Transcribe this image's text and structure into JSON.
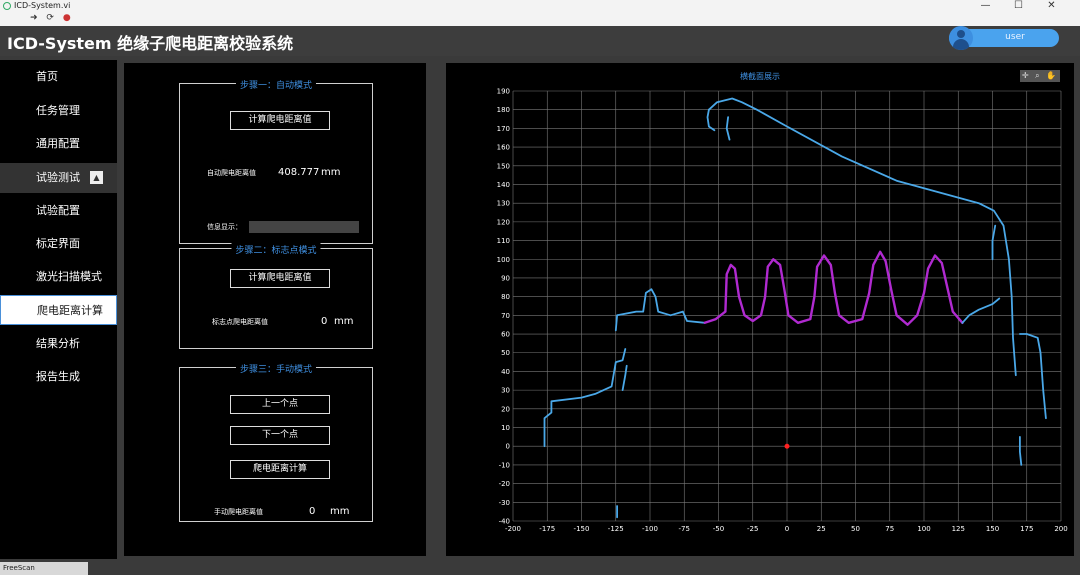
{
  "window": {
    "app_name": "ICD-System.vi",
    "run_tools": "➜ ⟳",
    "stop_glyph": "●",
    "minimize": "—",
    "maximize": "☐",
    "close": "✕"
  },
  "header": {
    "title": "ICD-System 绝缘子爬电距离校验系统",
    "user": "user"
  },
  "sidebar": {
    "items": [
      {
        "label": "首页"
      },
      {
        "label": "任务管理"
      },
      {
        "label": "通用配置"
      },
      {
        "label": "试验测试"
      },
      {
        "label": "试验配置"
      },
      {
        "label": "标定界面"
      },
      {
        "label": "激光扫描模式"
      },
      {
        "label": "爬电距离计算"
      },
      {
        "label": "结果分析"
      },
      {
        "label": "报告生成"
      }
    ],
    "collapse_glyph": "▲"
  },
  "steps": {
    "auto": {
      "title": "步骤一：自动模式",
      "button": "计算爬电距离值",
      "value_label": "自动爬电距离值",
      "value": "408.777",
      "unit": "mm",
      "info_label": "信息显示："
    },
    "marker": {
      "title": "步骤二：标志点模式",
      "button": "计算爬电距离值",
      "value_label": "标志点爬电距离值",
      "value": "0",
      "unit": "mm"
    },
    "manual": {
      "title": "步骤三：手动模式",
      "prev_button": "上一个点",
      "next_button": "下一个点",
      "calc_button": "爬电距离计算",
      "value_label": "手动爬电距离值",
      "value": "0",
      "unit": "mm"
    }
  },
  "chart_panel": {
    "tools": "✛ ⌕ ✋"
  },
  "chart_data": {
    "type": "scatter",
    "title": "横截面展示",
    "xlabel": "",
    "ylabel": "",
    "xlim": [
      -200,
      200
    ],
    "ylim": [
      -40,
      190
    ],
    "grid": true,
    "x_ticks": [
      -200,
      -175,
      -150,
      -125,
      -100,
      -75,
      -50,
      -25,
      0,
      25,
      50,
      75,
      100,
      125,
      150,
      175,
      200
    ],
    "y_ticks": [
      -40,
      -30,
      -20,
      -10,
      0,
      10,
      20,
      30,
      40,
      50,
      60,
      70,
      80,
      90,
      100,
      110,
      120,
      130,
      140,
      150,
      160,
      170,
      180,
      190
    ],
    "colors": {
      "scan": "#4aa8e8",
      "shed": "#b02ad0",
      "marker": "#ff2020"
    },
    "series": [
      {
        "points": [
          [
            -177,
            0
          ],
          [
            -177,
            15
          ],
          [
            -172,
            18
          ],
          [
            -172,
            24
          ],
          [
            -150,
            26
          ],
          [
            -140,
            28
          ],
          [
            -128,
            32
          ],
          [
            -125,
            45
          ],
          [
            -120,
            46
          ],
          [
            -118,
            52
          ]
        ]
      },
      {
        "points": [
          [
            -120,
            30
          ],
          [
            -118,
            38
          ],
          [
            -117,
            43
          ]
        ]
      },
      {
        "points": [
          [
            -125,
            62
          ],
          [
            -124,
            70
          ],
          [
            -110,
            72
          ],
          [
            -105,
            72
          ],
          [
            -103,
            82
          ],
          [
            -99,
            84
          ],
          [
            -96,
            80
          ],
          [
            -94,
            72
          ],
          [
            -85,
            70
          ],
          [
            -76,
            72
          ],
          [
            -73,
            67
          ],
          [
            -60,
            66
          ]
        ]
      },
      {
        "points": [
          [
            -60,
            66
          ],
          [
            -52,
            68
          ],
          [
            -45,
            72
          ],
          [
            -44,
            92
          ],
          [
            -41,
            97
          ],
          [
            -38,
            95
          ],
          [
            -35,
            80
          ],
          [
            -31,
            70
          ],
          [
            -25,
            67
          ],
          [
            -19,
            70
          ],
          [
            -16,
            80
          ],
          [
            -14,
            96
          ],
          [
            -10,
            100
          ],
          [
            -5,
            97
          ],
          [
            -2,
            84
          ],
          [
            1,
            70
          ],
          [
            8,
            66
          ],
          [
            17,
            68
          ],
          [
            20,
            80
          ],
          [
            22,
            96
          ],
          [
            27,
            102
          ],
          [
            32,
            97
          ],
          [
            35,
            82
          ],
          [
            38,
            70
          ],
          [
            45,
            66
          ],
          [
            55,
            68
          ],
          [
            60,
            82
          ],
          [
            63,
            97
          ],
          [
            68,
            104
          ],
          [
            72,
            99
          ],
          [
            76,
            84
          ],
          [
            80,
            70
          ],
          [
            88,
            65
          ],
          [
            95,
            70
          ],
          [
            100,
            82
          ],
          [
            103,
            95
          ],
          [
            108,
            102
          ],
          [
            113,
            98
          ],
          [
            117,
            85
          ],
          [
            121,
            72
          ],
          [
            128,
            66
          ]
        ]
      },
      {
        "points": [
          [
            128,
            66
          ],
          [
            133,
            70
          ],
          [
            140,
            73
          ],
          [
            150,
            76
          ],
          [
            155,
            79
          ]
        ]
      },
      {
        "points": [
          [
            -57,
            180
          ],
          [
            -51,
            184
          ],
          [
            -40,
            186
          ],
          [
            -33,
            184
          ],
          [
            -22,
            180
          ],
          [
            0,
            171
          ],
          [
            40,
            155
          ],
          [
            80,
            142
          ],
          [
            120,
            134
          ],
          [
            140,
            130
          ],
          [
            151,
            126
          ],
          [
            158,
            118
          ],
          [
            162,
            100
          ],
          [
            164,
            80
          ],
          [
            165,
            58
          ],
          [
            167,
            38
          ]
        ]
      },
      {
        "points": [
          [
            -57,
            180
          ],
          [
            -58,
            176
          ],
          [
            -57,
            171
          ],
          [
            -53,
            169
          ]
        ]
      },
      {
        "points": [
          [
            -43,
            176
          ],
          [
            -44,
            170
          ],
          [
            -42,
            164
          ]
        ]
      },
      {
        "points": [
          [
            152,
            118
          ],
          [
            150,
            110
          ],
          [
            150,
            100
          ]
        ]
      },
      {
        "points": [
          [
            170,
            60
          ],
          [
            175,
            60
          ],
          [
            183,
            58
          ],
          [
            185,
            50
          ],
          [
            187,
            30
          ],
          [
            189,
            15
          ]
        ]
      },
      {
        "points": [
          [
            170,
            5
          ],
          [
            170,
            -3
          ],
          [
            171,
            -10
          ]
        ]
      },
      {
        "points": [
          [
            -124,
            -32
          ],
          [
            -124,
            -38
          ]
        ]
      }
    ],
    "marker": [
      0,
      0
    ]
  },
  "statusbar": {
    "tab": "FreeScan"
  }
}
